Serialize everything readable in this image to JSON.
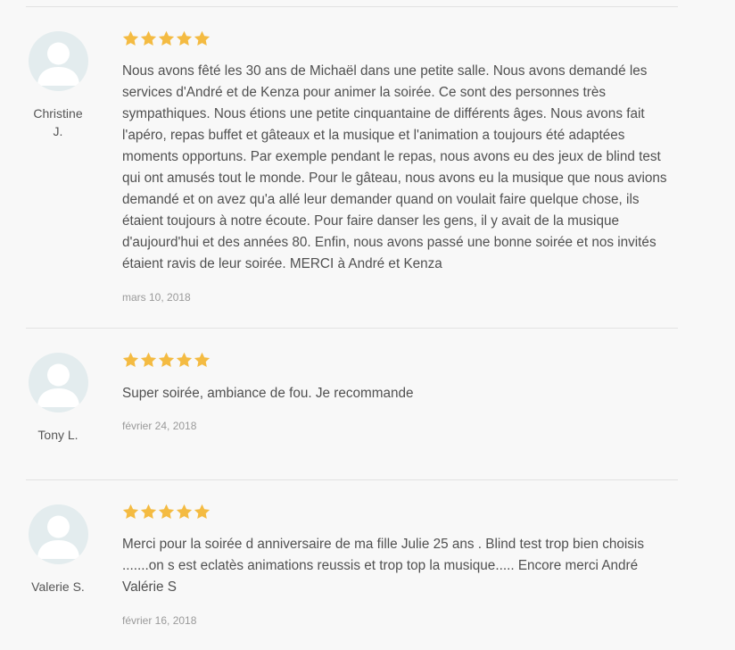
{
  "reviews": [
    {
      "author": "Christine J.",
      "rating": 5,
      "text": "Nous avons fêté les 30 ans de Michaël dans une petite salle. Nous avons demandé les services d'André et de Kenza pour animer la soirée. Ce sont des personnes très sympathiques. Nous étions une petite cinquantaine de différents âges. Nous avons fait l'apéro, repas buffet et gâteaux et la musique et l'animation a toujours été adaptées moments opportuns. Par exemple pendant le repas, nous avons eu des jeux de blind test qui ont amusés tout le monde. Pour le gâteau, nous avons eu la musique que nous avions demandé et on avez qu'a allé leur demander quand on voulait faire quelque chose, ils étaient toujours à notre écoute. Pour faire danser les gens, il y avait de la musique d'aujourd'hui et des années 80. Enfin, nous avons passé une bonne soirée et nos invités étaient ravis de leur soirée. MERCI à André et Kenza",
      "date": "mars 10, 2018"
    },
    {
      "author": "Tony L.",
      "rating": 5,
      "text": "Super soirée, ambiance de fou. Je recommande",
      "date": "février 24, 2018"
    },
    {
      "author": "Valerie S.",
      "rating": 5,
      "text": "Merci pour la soirée d anniversaire de ma fille Julie 25 ans . Blind test trop bien choisis .......on s est eclatès animations reussis et trop top la musique..... Encore merci André Valérie S",
      "date": "février 16, 2018"
    }
  ],
  "colors": {
    "star": "#f4bb42",
    "avatar_bg": "#e3ecee",
    "avatar_fg": "#ffffff",
    "divider": "#e2e2e2",
    "text": "#505050",
    "date": "#9a9a9a"
  },
  "icons": {
    "avatar": "user-silhouette-icon",
    "star": "star-icon"
  }
}
